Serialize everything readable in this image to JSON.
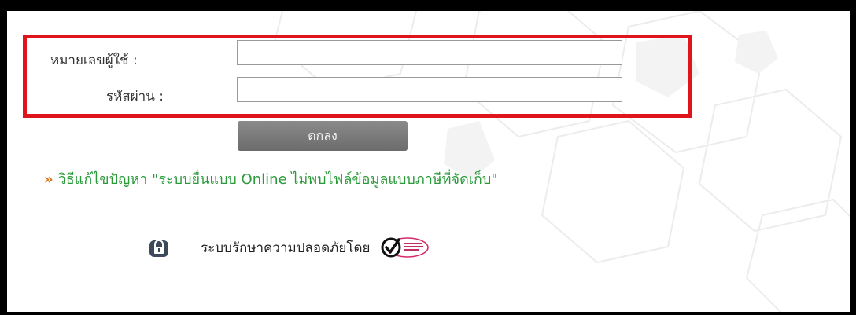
{
  "login": {
    "username_label": "หมายเลขผู้ใช้ :",
    "password_label": "รหัสผ่าน :",
    "username_value": "",
    "password_value": "",
    "submit_label": "ตกลง"
  },
  "help": {
    "arrow": "»",
    "text": "วิธีแก้ไขปัญหา \"ระบบยื่นแบบ Online ไม่พบไฟล์ข้อมูลแบบภาษีที่จัดเก็บ\""
  },
  "security": {
    "text": "ระบบรักษาความปลอดภัยโดย",
    "lock_icon": "lock-icon",
    "seal_icon": "security-seal-icon"
  },
  "colors": {
    "highlight": "#e0141b",
    "help_link": "#2a9a3a",
    "arrow": "#e07010",
    "button": "#777777"
  }
}
